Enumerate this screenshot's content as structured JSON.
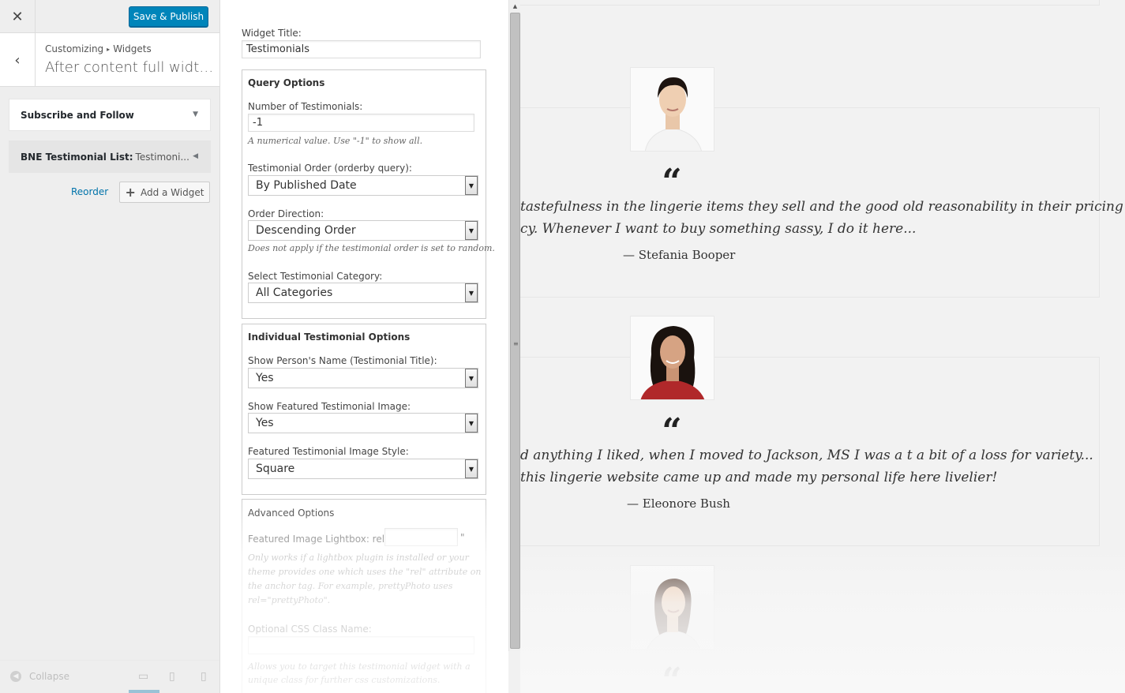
{
  "topbar": {
    "close_icon": "close-icon",
    "save_label": "Save & Publish"
  },
  "section": {
    "breadcrumb_parent": "Customizing",
    "breadcrumb_child": "Widgets",
    "title": "After content full width ..."
  },
  "widgets": {
    "items": [
      {
        "title": "Subscribe and Follow",
        "subtitle": ""
      },
      {
        "title": "BNE Testimonial List:",
        "subtitle": "Testimoni..."
      }
    ],
    "reorder_label": "Reorder",
    "add_widget_label": "Add a Widget"
  },
  "footer": {
    "collapse_label": "Collapse"
  },
  "form": {
    "widget_title_label": "Widget Title:",
    "widget_title_value": "Testimonials",
    "query": {
      "legend": "Query Options",
      "number_label": "Number of Testimonials:",
      "number_value": "-1",
      "number_hint": "A numerical value. Use \"-1\" to show all.",
      "order_label": "Testimonial Order (orderby query):",
      "order_value": "By Published Date",
      "direction_label": "Order Direction:",
      "direction_value": "Descending Order",
      "direction_hint": "Does not apply if the testimonial order is set to random.",
      "category_label": "Select Testimonial Category:",
      "category_value": "All Categories"
    },
    "individual": {
      "legend": "Individual Testimonial Options",
      "name_label": "Show Person's Name (Testimonial Title):",
      "name_value": "Yes",
      "image_label": "Show Featured Testimonial Image:",
      "image_value": "Yes",
      "style_label": "Featured Testimonial Image Style:",
      "style_value": "Square"
    },
    "advanced": {
      "legend": "Advanced Options",
      "lightbox_label": "Featured Image Lightbox: rel=\"",
      "lightbox_suffix": "\"",
      "lightbox_hint_1": "Only works if a lightbox plugin is installed or your",
      "lightbox_hint_2": "theme provides one which uses the \"rel\" attribute on",
      "lightbox_hint_3": "the anchor tag. For example, prettyPhoto uses",
      "lightbox_hint_4": "rel=\"prettyPhoto\".",
      "css_label": "Optional CSS Class Name:",
      "css_hint_1": "Allows you to target this testimonial widget with a",
      "css_hint_2": "unique class for further css customizations."
    }
  },
  "preview": {
    "quote_glyph": "“",
    "testimonials": [
      {
        "line1": "tastefulness in the lingerie items they sell and the good old reasonability in their pricing",
        "line2": "cy. Whenever I want to buy something sassy, I do it here...",
        "author": "— Stefania Booper"
      },
      {
        "line1": "d anything I liked, when I moved to Jackson, MS I was a t a bit of a loss for variety...",
        "line2": "this lingerie website came up and made my personal life here livelier!",
        "author": "— Eleonore Bush"
      },
      {
        "line1": "",
        "line2": "",
        "author": ""
      }
    ]
  },
  "colors": {
    "accent": "#0085ba",
    "link": "#0073aa"
  }
}
